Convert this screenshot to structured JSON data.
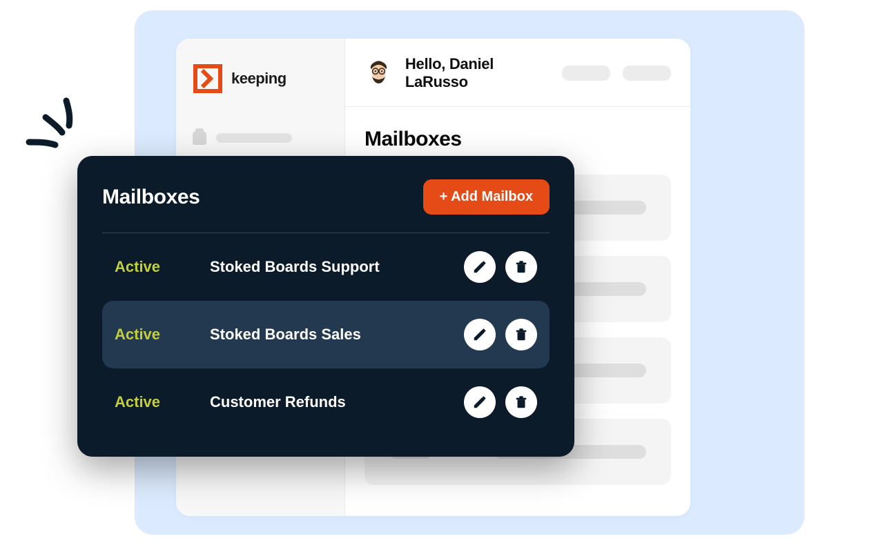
{
  "brand": {
    "name": "keeping"
  },
  "header": {
    "greeting": "Hello, Daniel LaRusso"
  },
  "section": {
    "title": "Mailboxes"
  },
  "modal": {
    "title": "Mailboxes",
    "add_button": "+ Add Mailbox",
    "rows": [
      {
        "status": "Active",
        "name": "Stoked Boards Support",
        "highlight": false
      },
      {
        "status": "Active",
        "name": "Stoked Boards Sales",
        "highlight": true
      },
      {
        "status": "Active",
        "name": "Customer Refunds",
        "highlight": false
      }
    ]
  },
  "colors": {
    "accent": "#e44b16",
    "panel_dark": "#0c1b2a",
    "active_label": "#c3cf3a",
    "bg_blue": "#dbeafe"
  }
}
